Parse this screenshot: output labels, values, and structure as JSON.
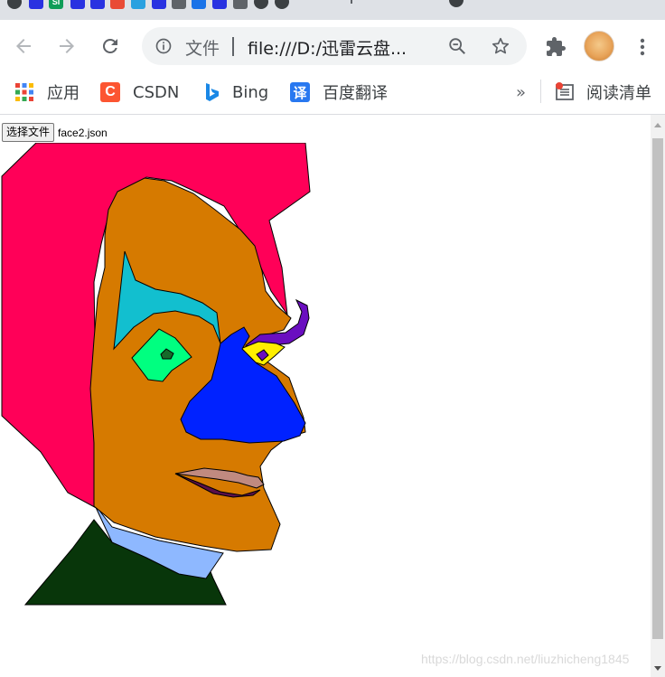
{
  "tabs": {
    "favicons": [
      "github-icon",
      "baidu-icon",
      "si-icon",
      "baidu-icon",
      "baidu-icon",
      "red-app-icon",
      "layers-icon",
      "baidu-icon",
      "edit-icon",
      "blue-app-icon",
      "baidu-icon",
      "edit-icon",
      "github-icon",
      "github-icon"
    ]
  },
  "omnibox": {
    "security_label": "文件",
    "url": "file:///D:/迅雷云盘..."
  },
  "bookmarks": {
    "items": [
      {
        "label": "应用",
        "icon": "apps-grid-icon"
      },
      {
        "label": "CSDN",
        "icon": "csdn-icon",
        "icon_text": "C"
      },
      {
        "label": "Bing",
        "icon": "bing-icon"
      },
      {
        "label": "百度翻译",
        "icon": "baidu-translate-icon",
        "icon_text": "译"
      }
    ],
    "overflow": "»",
    "reading_list": "阅读清单"
  },
  "page": {
    "choose_file_button": "选择文件",
    "file_name": "face2.json"
  },
  "colors": {
    "hair": "#ff0058",
    "skin": "#d67a00",
    "eye_shadow": "#12bfcf",
    "left_eye": "#00ff80",
    "right_eye": "#ffef00",
    "eyebrow": "#6a0ec0",
    "nose": "#0022ff",
    "upper_lip": "#c08a80",
    "lower_lip": "#5a0f4a",
    "collar": "#8eb8ff",
    "shirt": "#08360a"
  },
  "watermark": "https://blog.csdn.net/liuzhicheng1845"
}
